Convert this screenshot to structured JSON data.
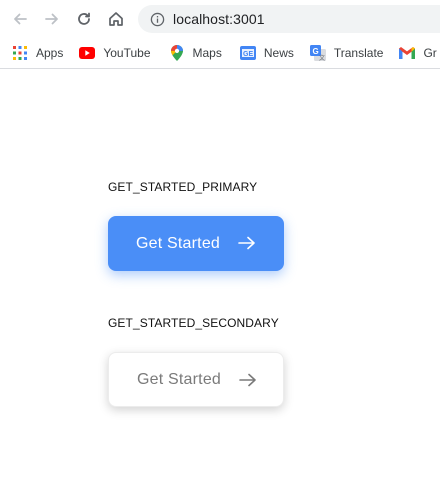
{
  "browser": {
    "url": "localhost:3001",
    "bookmarks": [
      {
        "label": "Apps",
        "icon": "apps-grid-icon"
      },
      {
        "label": "YouTube",
        "icon": "youtube-icon"
      },
      {
        "label": "Maps",
        "icon": "maps-pin-icon"
      },
      {
        "label": "News",
        "icon": "news-icon"
      },
      {
        "label": "Translate",
        "icon": "translate-icon"
      },
      {
        "label": "Gr",
        "icon": "gmail-icon"
      }
    ]
  },
  "page": {
    "primary_label": "GET_STARTED_PRIMARY",
    "primary_button": "Get Started",
    "secondary_label": "GET_STARTED_SECONDARY",
    "secondary_button": "Get Started"
  },
  "colors": {
    "primary": "#4a8ef7",
    "secondary_text": "#7a7a7a"
  }
}
